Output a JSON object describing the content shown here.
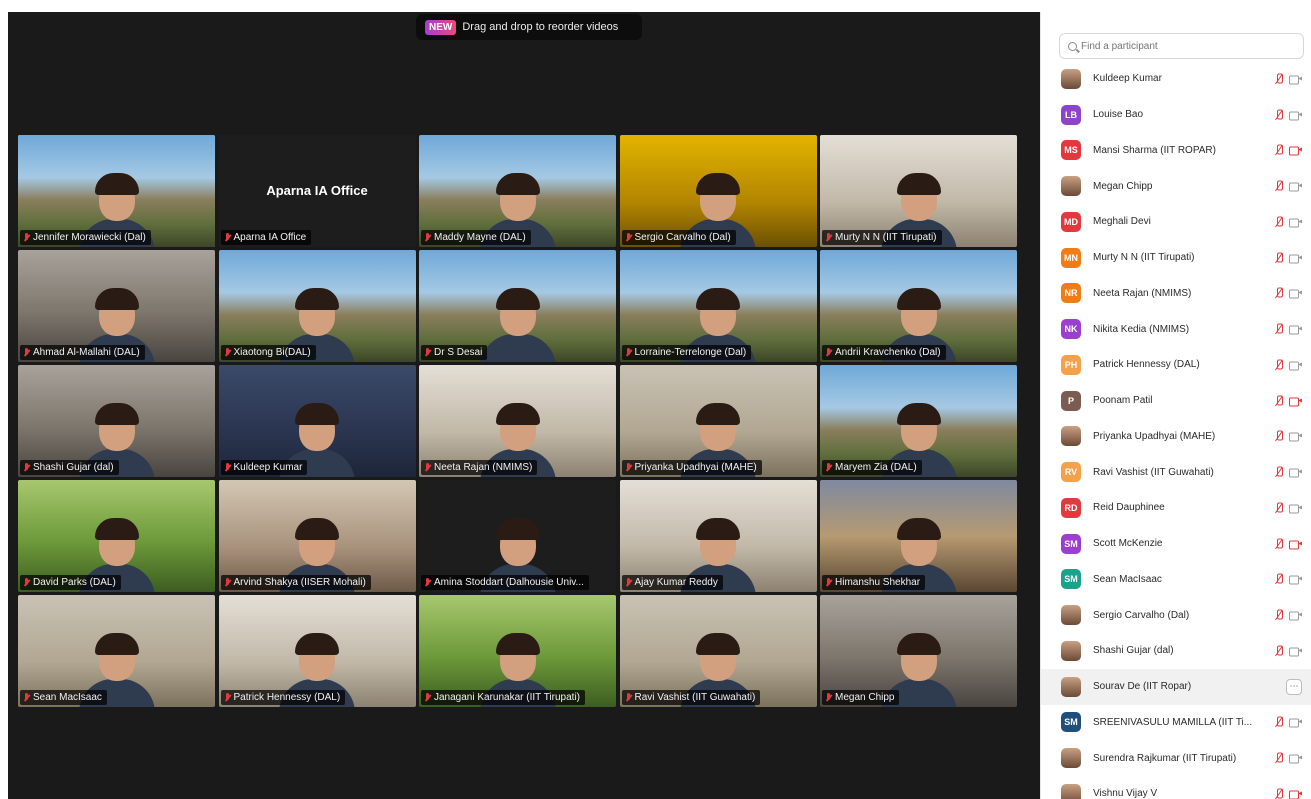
{
  "banner": {
    "badge": "NEW",
    "text": "Drag and drop to reorder videos"
  },
  "tiles": [
    {
      "name": "Jennifer Morawiecki (Dal)",
      "scene": "campus",
      "active": true
    },
    {
      "name": "Aparna IA Office",
      "scene": "dark",
      "center_label": "Aparna IA Office"
    },
    {
      "name": "Maddy Mayne (DAL)",
      "scene": "campus"
    },
    {
      "name": "Sergio Carvalho (Dal)",
      "scene": "gold"
    },
    {
      "name": "Murty N N (IIT Tirupati)",
      "scene": "room"
    },
    {
      "name": "Ahmad Al-Mallahi (DAL)",
      "scene": "office"
    },
    {
      "name": "Xiaotong Bi(DAL)",
      "scene": "campus"
    },
    {
      "name": "Dr S Desai",
      "scene": "campus"
    },
    {
      "name": "Lorraine-Terrelonge (Dal)",
      "scene": "campus"
    },
    {
      "name": "Andrii Kravchenko (Dal)",
      "scene": "campus"
    },
    {
      "name": "Shashi Gujar (dal)",
      "scene": "office"
    },
    {
      "name": "Kuldeep Kumar",
      "scene": "blue"
    },
    {
      "name": "Neeta Rajan (NMIMS)",
      "scene": "room"
    },
    {
      "name": "Priyanka Upadhyai (MAHE)",
      "scene": "wall"
    },
    {
      "name": "Maryem Zia (DAL)",
      "scene": "campus"
    },
    {
      "name": "David Parks (DAL)",
      "scene": "green"
    },
    {
      "name": "Arvind Shakya (IISER Mohali)",
      "scene": "warm"
    },
    {
      "name": "Amina Stoddart (Dalhousie Univ...",
      "scene": "dark"
    },
    {
      "name": "Ajay Kumar Reddy",
      "scene": "room"
    },
    {
      "name": "Himanshu Shekhar",
      "scene": "sunset"
    },
    {
      "name": "Sean MacIsaac",
      "scene": "wall"
    },
    {
      "name": "Patrick Hennessy (DAL)",
      "scene": "room"
    },
    {
      "name": "Janagani Karunakar (IIT Tirupati)",
      "scene": "green"
    },
    {
      "name": "Ravi Vashist (IIT Guwahati)",
      "scene": "wall"
    },
    {
      "name": "Megan Chipp",
      "scene": "office"
    }
  ],
  "participants_panel": {
    "search_placeholder": "Find a participant",
    "participants": [
      {
        "name": "Kuldeep Kumar",
        "initials": "",
        "avatar_color": "#6b4a36",
        "photo": true,
        "video_off": false
      },
      {
        "name": "Louise Bao",
        "initials": "LB",
        "avatar_color": "#8e44c9",
        "photo": false,
        "video_off": false
      },
      {
        "name": "Mansi Sharma (IIT ROPAR)",
        "initials": "MS",
        "avatar_color": "#e0393e",
        "photo": false,
        "video_off": true
      },
      {
        "name": "Megan Chipp",
        "initials": "",
        "avatar_color": "#6b4a36",
        "photo": true,
        "video_off": false
      },
      {
        "name": "Meghali Devi",
        "initials": "MD",
        "avatar_color": "#e0393e",
        "photo": false,
        "video_off": false
      },
      {
        "name": "Murty N N (IIT Tirupati)",
        "initials": "MN",
        "avatar_color": "#f07c16",
        "photo": false,
        "video_off": false
      },
      {
        "name": "Neeta Rajan (NMIMS)",
        "initials": "NR",
        "avatar_color": "#f07c16",
        "photo": false,
        "video_off": false
      },
      {
        "name": "Nikita Kedia (NMIMS)",
        "initials": "NK",
        "avatar_color": "#9b3fd0",
        "photo": false,
        "video_off": false
      },
      {
        "name": "Patrick Hennessy (DAL)",
        "initials": "PH",
        "avatar_color": "#f4a14a",
        "photo": false,
        "video_off": false
      },
      {
        "name": "Poonam Patil",
        "initials": "P",
        "avatar_color": "#7a5c52",
        "photo": false,
        "video_off": true
      },
      {
        "name": "Priyanka Upadhyai (MAHE)",
        "initials": "",
        "avatar_color": "#6b4a36",
        "photo": true,
        "video_off": false
      },
      {
        "name": "Ravi Vashist (IIT Guwahati)",
        "initials": "RV",
        "avatar_color": "#f4a14a",
        "photo": false,
        "video_off": false
      },
      {
        "name": "Reid Dauphinee",
        "initials": "RD",
        "avatar_color": "#e0393e",
        "photo": false,
        "video_off": false
      },
      {
        "name": "Scott McKenzie",
        "initials": "SM",
        "avatar_color": "#9b3fd0",
        "photo": false,
        "video_off": true
      },
      {
        "name": "Sean MacIsaac",
        "initials": "SM",
        "avatar_color": "#1aa28b",
        "photo": false,
        "video_off": false
      },
      {
        "name": "Sergio Carvalho (Dal)",
        "initials": "",
        "avatar_color": "#6b4a36",
        "photo": true,
        "video_off": false
      },
      {
        "name": "Shashi Gujar (dal)",
        "initials": "",
        "avatar_color": "#6b4a36",
        "photo": true,
        "video_off": false
      },
      {
        "name": "Sourav De (IIT Ropar)",
        "initials": "",
        "avatar_color": "#6b4a36",
        "photo": true,
        "video_off": false,
        "highlighted": true
      },
      {
        "name": "SREENIVASULU MAMILLA (IIT Ti...",
        "initials": "SM",
        "avatar_color": "#1f4f7a",
        "photo": false,
        "video_off": false
      },
      {
        "name": "Surendra Rajkumar (IIT Tirupati)",
        "initials": "",
        "avatar_color": "#6b4a36",
        "photo": true,
        "video_off": false
      },
      {
        "name": "Vishnu Vijay V",
        "initials": "",
        "avatar_color": "#6b4a36",
        "photo": true,
        "video_off": true
      }
    ]
  }
}
